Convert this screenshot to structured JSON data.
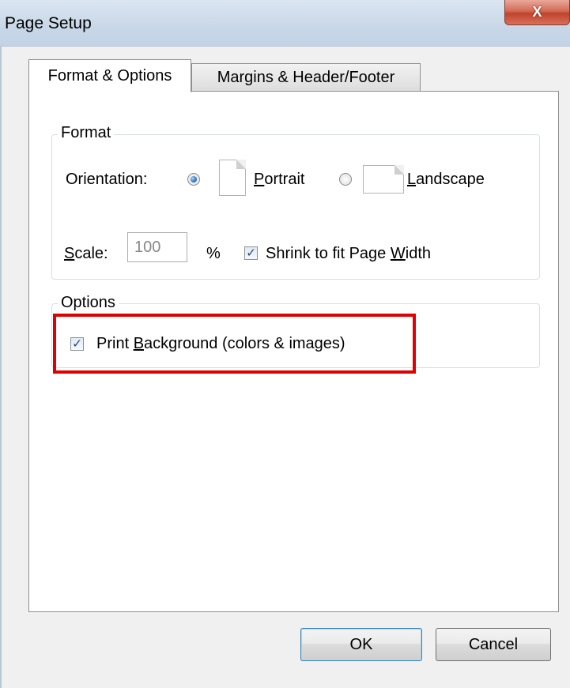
{
  "window": {
    "title": "Page Setup",
    "close_glyph": "X"
  },
  "tabs": [
    {
      "label": "Format & Options",
      "active": true
    },
    {
      "label": "Margins & Header/Footer",
      "active": false
    }
  ],
  "format_group": {
    "legend": "Format",
    "orientation_label": "Orientation:",
    "portrait": {
      "pre": "",
      "key": "P",
      "post": "ortrait",
      "checked": true
    },
    "landscape": {
      "pre": "",
      "key": "L",
      "post": "andscape",
      "checked": false
    },
    "scale": {
      "key": "S",
      "post": "cale:",
      "value": "100",
      "unit": "%"
    },
    "shrink": {
      "pre": "Shrink to fit Page ",
      "key": "W",
      "post": "idth",
      "checked": true
    }
  },
  "options_group": {
    "legend": "Options",
    "print_background": {
      "pre": "Print ",
      "key": "B",
      "post": "ackground (colors & images)",
      "checked": true
    }
  },
  "buttons": {
    "ok": "OK",
    "cancel": "Cancel"
  },
  "colors": {
    "highlight": "#e00000",
    "close_button": "#c0442c"
  },
  "icons": {
    "checkbox_check": "✓"
  }
}
